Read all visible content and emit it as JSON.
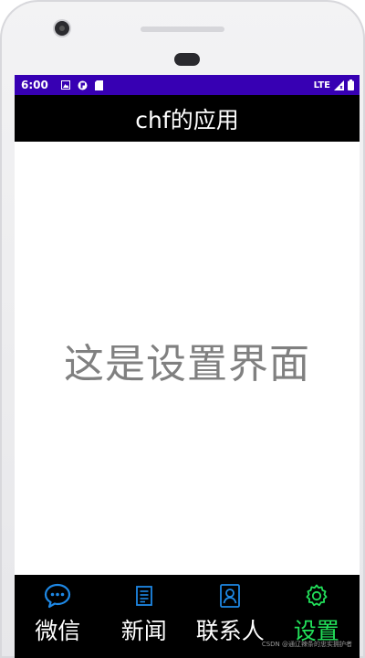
{
  "status_bar": {
    "time": "6:00",
    "network": "LTE"
  },
  "app_bar": {
    "title": "chf的应用"
  },
  "content": {
    "message": "这是设置界面"
  },
  "bottom_nav": {
    "items": [
      {
        "label": "微信",
        "icon": "chat-icon",
        "active": false
      },
      {
        "label": "新闻",
        "icon": "news-icon",
        "active": false
      },
      {
        "label": "联系人",
        "icon": "contact-icon",
        "active": false
      },
      {
        "label": "设置",
        "icon": "gear-icon",
        "active": true
      }
    ]
  },
  "watermark": "CSDN @通辽辣条的忠实拥护者",
  "colors": {
    "status_bar": "#3700b3",
    "app_bar": "#000000",
    "icon_blue": "#1e88e5",
    "active_green": "#22e05a",
    "content_text": "#808080"
  }
}
